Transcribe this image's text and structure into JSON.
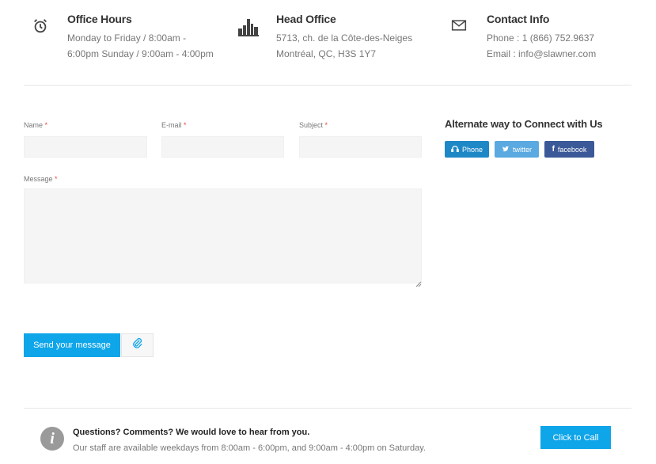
{
  "office_hours": {
    "title": "Office Hours",
    "line1": "Monday to Friday / 8:00am -",
    "line2": "6:00pm Sunday / 9:00am - 4:00pm",
    "icon": "alarm-clock-icon"
  },
  "head_office": {
    "title": "Head Office",
    "line1": "5713, ch. de la Côte-des-Neiges",
    "line2": "Montréal, QC, H3S 1Y7",
    "icon": "city-skyline-icon"
  },
  "contact_info": {
    "title": "Contact Info",
    "line1": "Phone : 1 (866) 752.9637",
    "line2": "Email : info@slawner.com",
    "icon": "envelope-icon"
  },
  "form": {
    "name_label": "Name",
    "email_label": "E-mail",
    "subject_label": "Subject",
    "message_label": "Message",
    "required_mark": "*",
    "name_value": "",
    "email_value": "",
    "subject_value": "",
    "message_value": "",
    "send_label": "Send your message",
    "attach_icon": "paperclip-icon"
  },
  "alternate": {
    "title": "Alternate way to Connect with Us",
    "buttons": [
      {
        "label": "Phone",
        "icon": "headset-icon",
        "color": "#1e88c7"
      },
      {
        "label": "twitter",
        "icon": "twitter-bird-icon",
        "color": "#5aa9e0"
      },
      {
        "label": "facebook",
        "icon": "facebook-f-icon",
        "color": "#3b5998"
      }
    ]
  },
  "footer": {
    "title": "Questions? Comments? We would love to hear from you.",
    "subtitle": "Our staff are available weekdays from 8:00am - 6:00pm, and 9:00am - 4:00pm on Saturday.",
    "info_icon": "info-icon",
    "call_label": "Click to Call"
  },
  "colors": {
    "accent": "#0ea5e9",
    "field_bg": "#f5f5f5",
    "required": "#e74c3c"
  }
}
